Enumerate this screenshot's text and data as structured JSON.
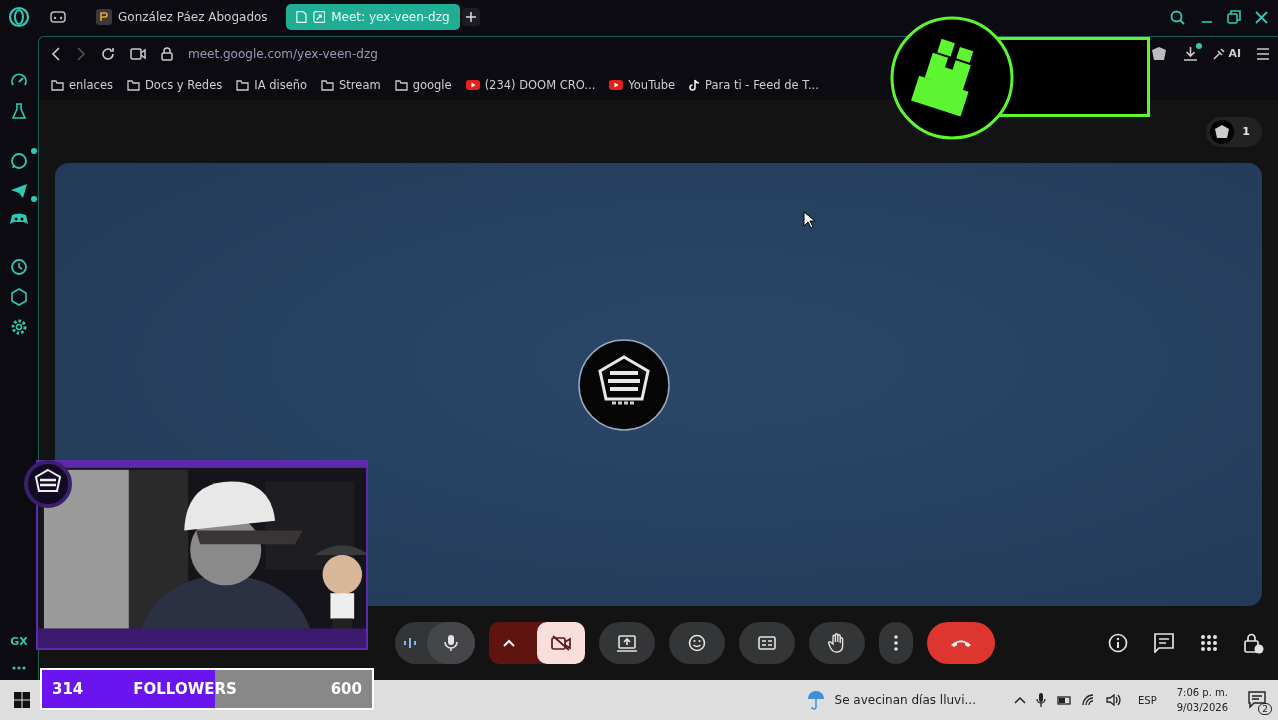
{
  "browser": {
    "tabs": [
      {
        "title": "González Páez Abogados",
        "selected": false
      },
      {
        "title": "Meet: yex-veen-dzg",
        "selected": true
      }
    ],
    "url": "meet.google.com/yex-veen-dzg",
    "bookmarks": [
      {
        "label": "enlaces",
        "kind": "folder"
      },
      {
        "label": "Docs y Redes",
        "kind": "folder"
      },
      {
        "label": "IA diseño",
        "kind": "folder"
      },
      {
        "label": "Stream",
        "kind": "folder"
      },
      {
        "label": "google",
        "kind": "folder"
      },
      {
        "label": "(234) DOOM CRO...",
        "kind": "youtube"
      },
      {
        "label": "YouTube",
        "kind": "youtube"
      },
      {
        "label": "Para ti - Feed de T...",
        "kind": "tiktok"
      }
    ],
    "ai_label": "AI"
  },
  "sidebar": {
    "gx_label": "GX"
  },
  "meet": {
    "participant_count": "1",
    "mic_on": true,
    "camera_on": false
  },
  "followers": {
    "count": "314",
    "label": "FOLLOWERS",
    "goal": "600",
    "level": 0.523
  },
  "taskbar": {
    "weather": "Se avecinan días lluvi...",
    "language": "ESP",
    "time": "7:06 p. m.",
    "date": "9/03/2026",
    "notifications": "2"
  }
}
